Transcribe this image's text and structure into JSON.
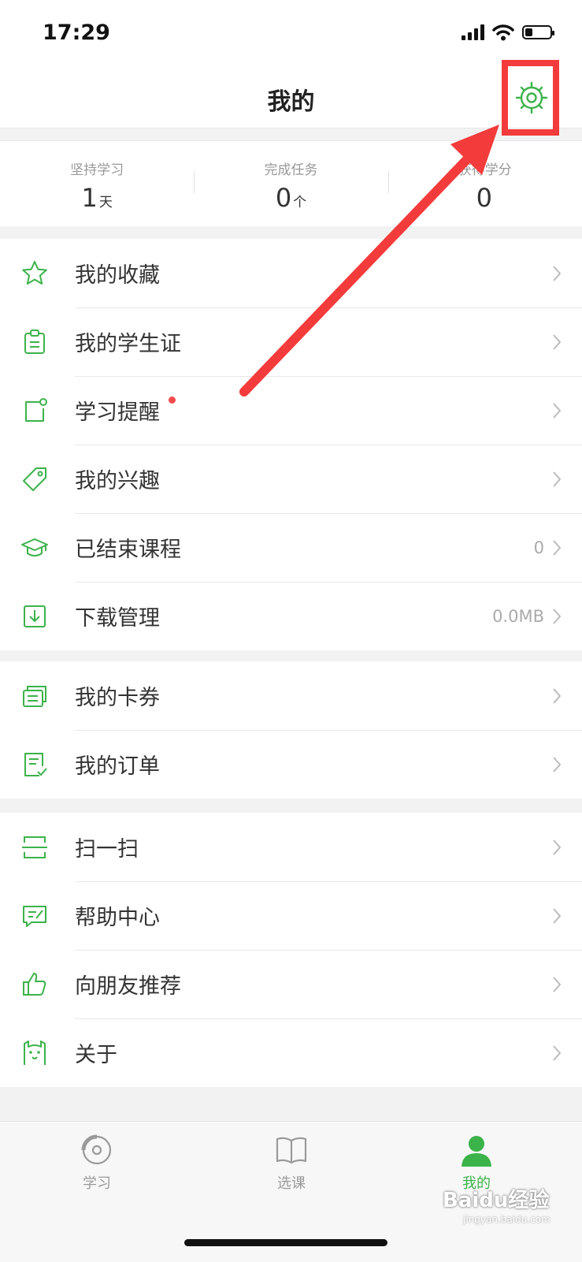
{
  "status_bar": {
    "time": "17:29"
  },
  "header": {
    "title": "我的",
    "settings_icon": "gear-icon"
  },
  "stats": [
    {
      "label": "坚持学习",
      "value": "1",
      "unit": "天"
    },
    {
      "label": "完成任务",
      "value": "0",
      "unit": "个"
    },
    {
      "label": "获得学分",
      "value": "0",
      "unit": ""
    }
  ],
  "menu_groups": [
    [
      {
        "label": "我的收藏",
        "icon": "star-icon",
        "value": ""
      },
      {
        "label": "我的学生证",
        "icon": "student-card-icon",
        "value": ""
      },
      {
        "label": "学习提醒",
        "icon": "reminder-icon",
        "value": "",
        "badge_dot": true
      },
      {
        "label": "我的兴趣",
        "icon": "tag-icon",
        "value": ""
      },
      {
        "label": "已结束课程",
        "icon": "graduation-cap-icon",
        "value": "0"
      },
      {
        "label": "下载管理",
        "icon": "download-icon",
        "value": "0.0MB"
      }
    ],
    [
      {
        "label": "我的卡券",
        "icon": "coupon-icon",
        "value": ""
      },
      {
        "label": "我的订单",
        "icon": "order-icon",
        "value": ""
      }
    ],
    [
      {
        "label": "扫一扫",
        "icon": "scan-icon",
        "value": ""
      },
      {
        "label": "帮助中心",
        "icon": "help-icon",
        "value": ""
      },
      {
        "label": "向朋友推荐",
        "icon": "thumbs-up-icon",
        "value": ""
      },
      {
        "label": "关于",
        "icon": "about-icon",
        "value": ""
      }
    ]
  ],
  "tabs": [
    {
      "label": "学习",
      "icon": "study-icon",
      "active": false
    },
    {
      "label": "选课",
      "icon": "book-icon",
      "active": false
    },
    {
      "label": "我的",
      "icon": "profile-icon",
      "active": true
    }
  ],
  "watermark": {
    "text": "Baidu经验",
    "sub": "jingyan.baidu.com"
  },
  "colors": {
    "accent": "#3cb34a",
    "annotation": "#f43b3b",
    "inactive_tab": "#9a9a9a"
  }
}
